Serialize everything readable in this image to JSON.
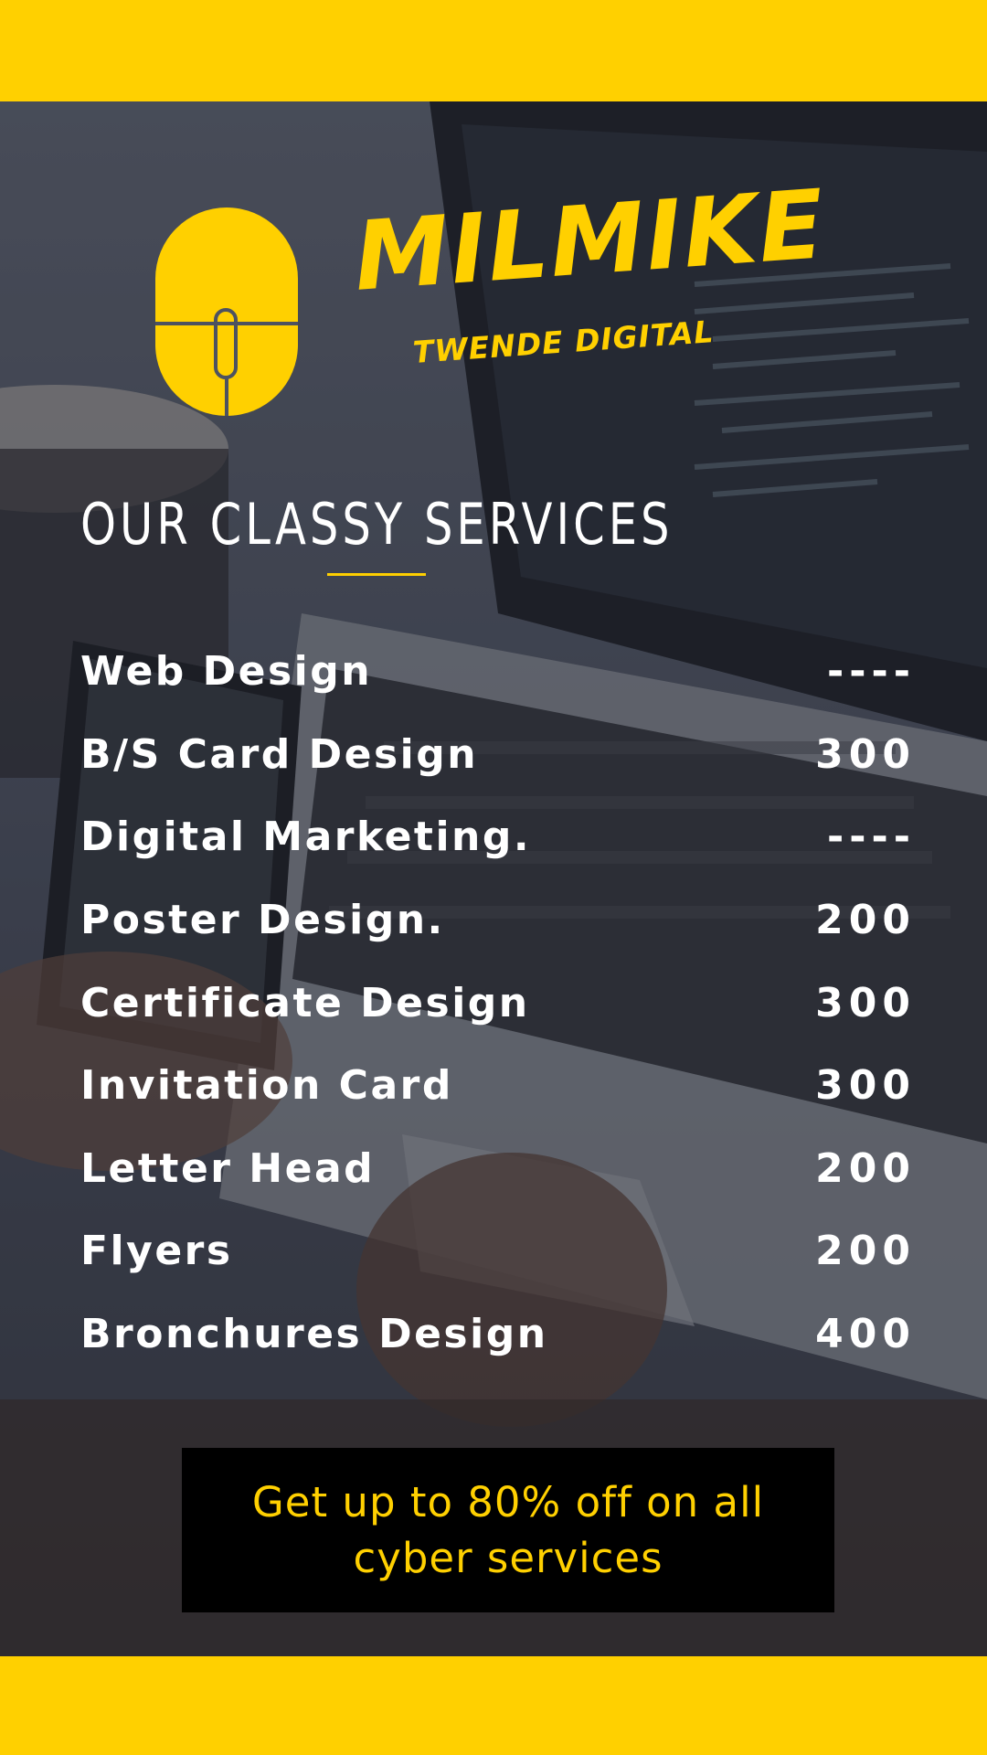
{
  "colors": {
    "accent": "#ffd000",
    "text": "#ffffff",
    "promo_bg": "#000000"
  },
  "brand": {
    "name": "MILMIKE",
    "tagline": "TWENDE DIGITAL",
    "logo_icon": "computer-mouse-icon"
  },
  "section": {
    "title": "OUR CLASSY SERVICES"
  },
  "services": [
    {
      "name": "Web Design",
      "price": "----"
    },
    {
      "name": "B/S Card Design",
      "price": "300"
    },
    {
      "name": "Digital Marketing.",
      "price": "----"
    },
    {
      "name": "Poster Design.",
      "price": "200"
    },
    {
      "name": "Certificate Design",
      "price": "300"
    },
    {
      "name": "Invitation Card",
      "price": "300"
    },
    {
      "name": "Letter Head",
      "price": "200"
    },
    {
      "name": "Flyers",
      "price": "200"
    },
    {
      "name": "Bronchures Design",
      "price": "400"
    }
  ],
  "promo": {
    "text": "Get up to 80% off on all cyber services"
  }
}
